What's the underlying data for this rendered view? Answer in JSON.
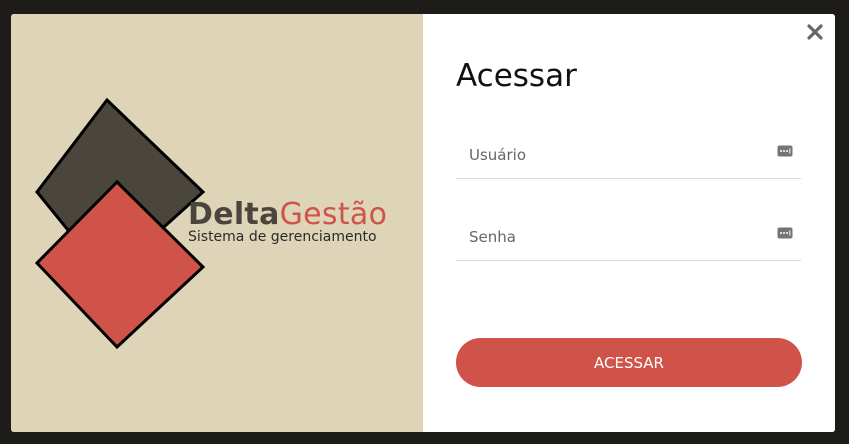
{
  "brand": {
    "name_bold": "Delta",
    "name_light": "Gestão",
    "tagline": "Sistema de gerenciamento",
    "colors": {
      "panel_bg": "#ded4b7",
      "dark_square": "#4a463d",
      "red_square": "#d0534a"
    }
  },
  "login": {
    "title": "Acessar",
    "username_placeholder": "Usuário",
    "password_placeholder": "Senha",
    "submit_label": "ACESSAR",
    "field_icon": "password-dots-icon",
    "close_icon": "close-icon"
  }
}
